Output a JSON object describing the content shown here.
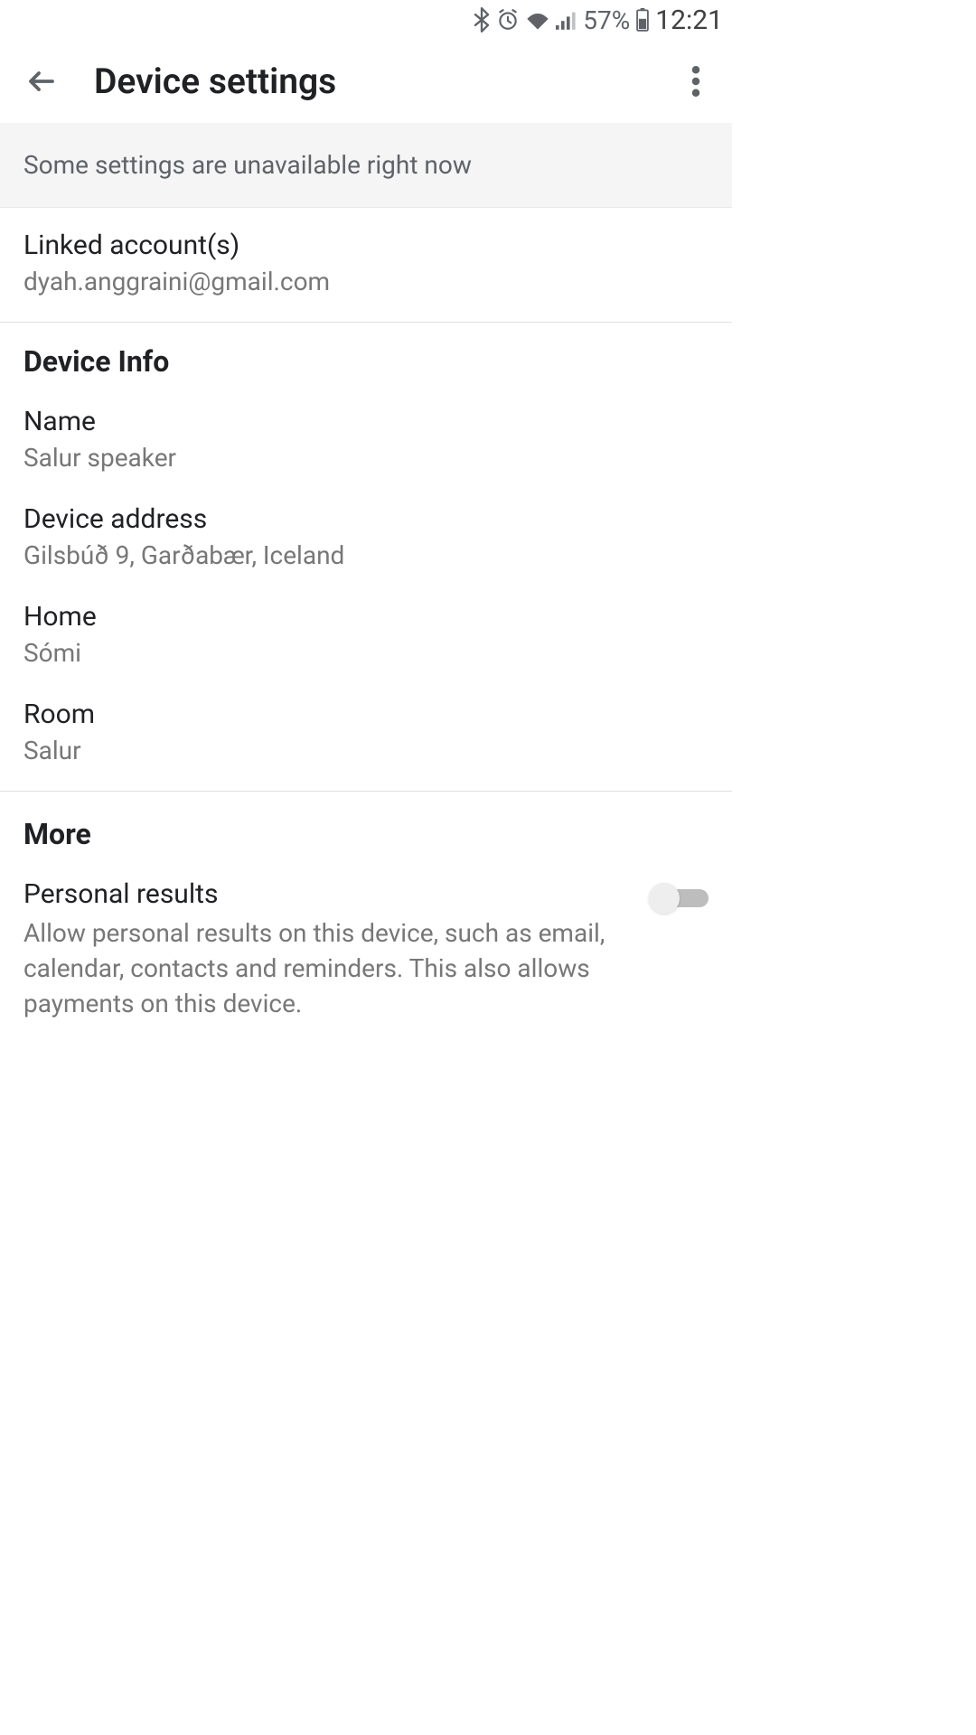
{
  "status_bar": {
    "battery_percent": "57%",
    "time": "12:21"
  },
  "header": {
    "title": "Device settings"
  },
  "banner": {
    "message": "Some settings are unavailable right now"
  },
  "linked_accounts": {
    "title": "Linked account(s)",
    "value": "dyah.anggraini@gmail.com"
  },
  "device_info": {
    "header": "Device Info",
    "name": {
      "label": "Name",
      "value": "Salur speaker"
    },
    "address": {
      "label": "Device address",
      "value": "Gilsbúð 9, Garðabær, Iceland"
    },
    "home": {
      "label": "Home",
      "value": "Sómi"
    },
    "room": {
      "label": "Room",
      "value": "Salur"
    }
  },
  "more": {
    "header": "More",
    "personal_results": {
      "title": "Personal results",
      "description": "Allow personal results on this device, such as email, calendar, contacts and reminders. This also allows payments on this device.",
      "enabled": false
    }
  }
}
